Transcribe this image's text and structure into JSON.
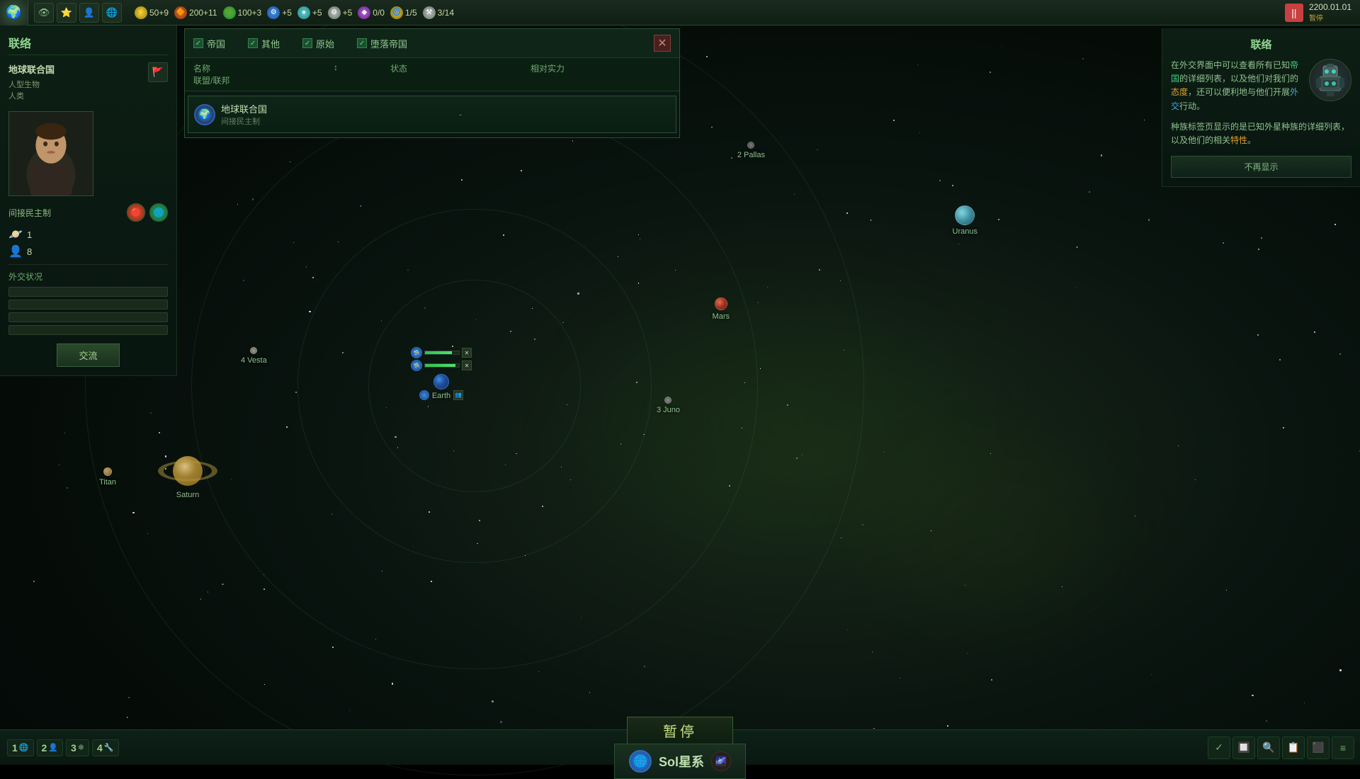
{
  "topbar": {
    "empire_icon": "🌍",
    "resources": [
      {
        "icon": "⚡",
        "type": "energy",
        "value": "50+9",
        "class": "res-energy"
      },
      {
        "icon": "🔶",
        "type": "minerals",
        "value": "200+11",
        "class": "res-minerals"
      },
      {
        "icon": "🌿",
        "type": "food",
        "value": "100+3",
        "class": "res-food"
      },
      {
        "icon": "⚙",
        "type": "engineering",
        "value": "+5",
        "class": "res-science"
      },
      {
        "icon": "🔵",
        "type": "consumer",
        "value": "+5",
        "class": "res-consumer"
      },
      {
        "icon": "⚙",
        "type": "alloys",
        "value": "+5",
        "class": "res-alloys"
      },
      {
        "icon": "◆",
        "type": "influence",
        "value": "0/0",
        "class": "res-influence"
      },
      {
        "icon": "🌀",
        "type": "unity",
        "value": "1/5",
        "class": "res-unity"
      },
      {
        "icon": "⚒",
        "type": "extra",
        "value": "3/14",
        "class": "res-alloys"
      }
    ],
    "nav_icons": [
      "👁",
      "⭐",
      "👤",
      "🌐"
    ],
    "pause_label": "||",
    "date": "2200.01.01",
    "paused": "暂停"
  },
  "left_panel": {
    "title": "联络",
    "empire_name": "地球联合国",
    "species_type": "人型生物",
    "species_name": "人类",
    "gov_type": "间接民主制",
    "stat_planet": "1",
    "stat_pop": "8",
    "diplo_status_label": "外交状况",
    "exchange_btn": "交流",
    "icon1": "🔴",
    "icon2": "🌐"
  },
  "diplo_modal": {
    "filters": [
      {
        "label": "帝国",
        "checked": true
      },
      {
        "label": "其他",
        "checked": true
      },
      {
        "label": "原始",
        "checked": true
      },
      {
        "label": "堕落帝国",
        "checked": true
      }
    ],
    "close_btn": "✕",
    "table_headers": [
      "名称",
      "↕",
      "状态",
      "相对实力",
      "联盟/联邦"
    ],
    "rows": [
      {
        "icon": "🌍",
        "name": "地球联合国",
        "gov": "间接民主制",
        "status": "-",
        "strength": "",
        "alliance": ""
      }
    ]
  },
  "right_panel": {
    "title": "联络",
    "avatar_icon": "🤖",
    "text1": "在外交界面中可以查看所有已知",
    "highlight1": "帝国",
    "text2": "的详细列表，以及他们对我们的",
    "highlight2": "态度",
    "text3": "，还可以便利地与他们开展",
    "highlight3": "外交",
    "text4": "行动。",
    "text5": "种族标签页显示的是已知外星种族的详细列表，以及他们的相关",
    "highlight4": "特性",
    "text6": "。",
    "no_show_btn": "不再显示"
  },
  "bottom_bar": {
    "groups": [
      {
        "num": "1",
        "icon": "🌐"
      },
      {
        "num": "2",
        "icon": "👤"
      },
      {
        "num": "3",
        "icon": "❄"
      },
      {
        "num": "4",
        "icon": "🔧"
      }
    ],
    "pause_text": "暂停",
    "system_name": "Sol星系",
    "system_icon": "🌐",
    "system_right_icon": "🌌"
  },
  "map": {
    "earth_label": "Earth",
    "saturn_label": "Saturn",
    "titan_label": "Titan",
    "uranus_label": "Uranus",
    "pallas_label": "2 Pallas",
    "mars_label": "Mars",
    "juno_label": "3 Juno",
    "vesta_label": "4 Vesta"
  },
  "bottom_right_icons": [
    "✓",
    "🔲",
    "🔍",
    "📋",
    "⬛",
    "≡"
  ]
}
